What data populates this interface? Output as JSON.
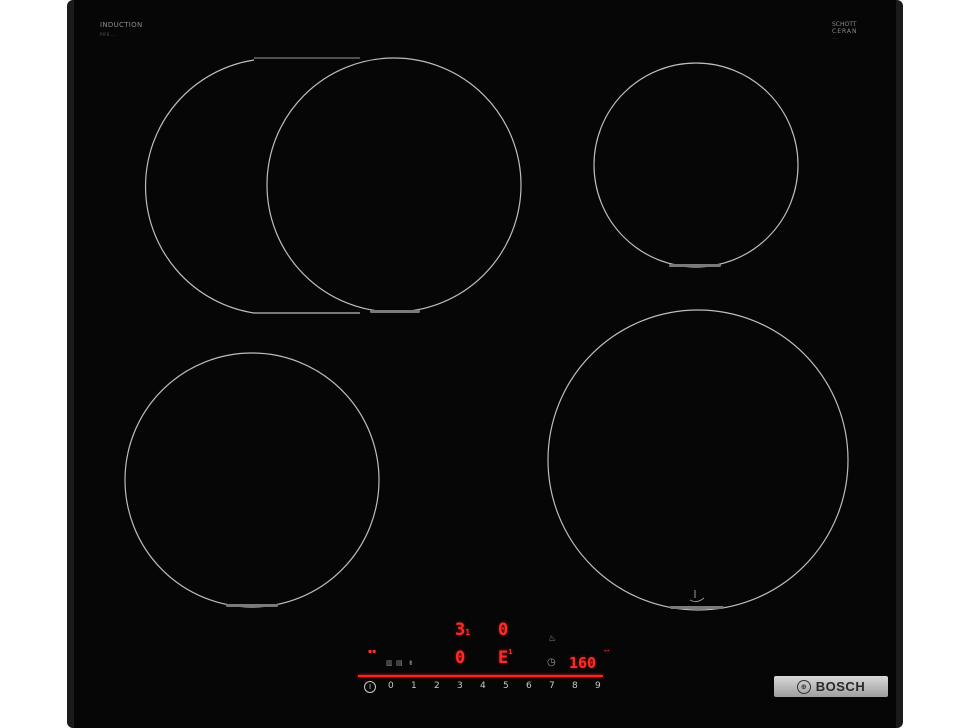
{
  "brand_top_left": {
    "line1": "INDUCTION",
    "line2": "PIF6...."
  },
  "brand_top_right": {
    "line1": "SCHOTT",
    "line2": "CERAN",
    "line3": "......"
  },
  "displays": {
    "top_left": "3",
    "top_left_suffix": "1",
    "top_right": "0",
    "bottom_left": "0",
    "bottom_mid": "E",
    "bottom_mid_sup": "1",
    "temperature": "160"
  },
  "slider": {
    "values": [
      "0",
      "·",
      "1",
      "·",
      "2",
      "·",
      "3",
      "·",
      "4",
      "·",
      "5",
      "·",
      "6",
      "·",
      "7",
      "·",
      "8",
      "·",
      "9"
    ],
    "display_labels": [
      "0",
      "1",
      "2",
      "3",
      "4",
      "5",
      "6",
      "7",
      "8",
      "9"
    ]
  },
  "power_symbol": "I",
  "brand_badge": {
    "logo": "⊕",
    "name": "BOSCH"
  },
  "colors": {
    "frame": "#1a1a1a",
    "glass": "#060606",
    "led": "#ff2a2a",
    "ring": "#bdbdbd"
  }
}
